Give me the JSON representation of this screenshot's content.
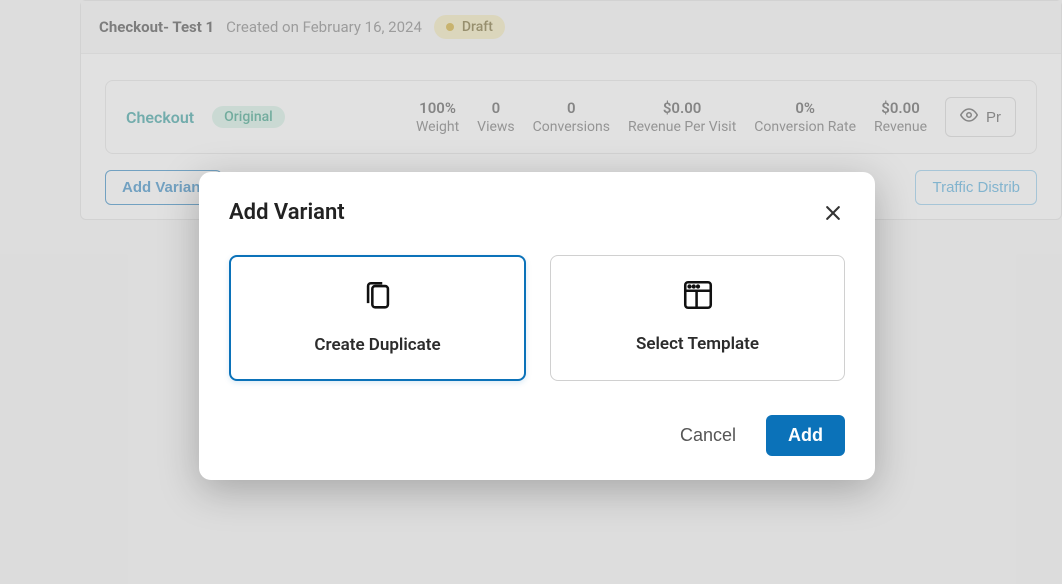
{
  "header": {
    "test_name": "Checkout- Test 1",
    "created_on": "Created on February 16, 2024",
    "status": "Draft"
  },
  "variant": {
    "name": "Checkout",
    "badge": "Original",
    "metrics": {
      "weight": {
        "value": "100%",
        "label": "Weight"
      },
      "views": {
        "value": "0",
        "label": "Views"
      },
      "conversions": {
        "value": "0",
        "label": "Conversions"
      },
      "rev_per_visit": {
        "value": "$0.00",
        "label": "Revenue Per Visit"
      },
      "conv_rate": {
        "value": "0%",
        "label": "Conversion Rate"
      },
      "revenue": {
        "value": "$0.00",
        "label": "Revenue"
      }
    },
    "preview_label": "Pr"
  },
  "actions": {
    "add_variant": "Add Variant",
    "traffic": "Traffic Distrib"
  },
  "modal": {
    "title": "Add Variant",
    "option_duplicate": "Create Duplicate",
    "option_template": "Select Template",
    "cancel": "Cancel",
    "add": "Add"
  }
}
